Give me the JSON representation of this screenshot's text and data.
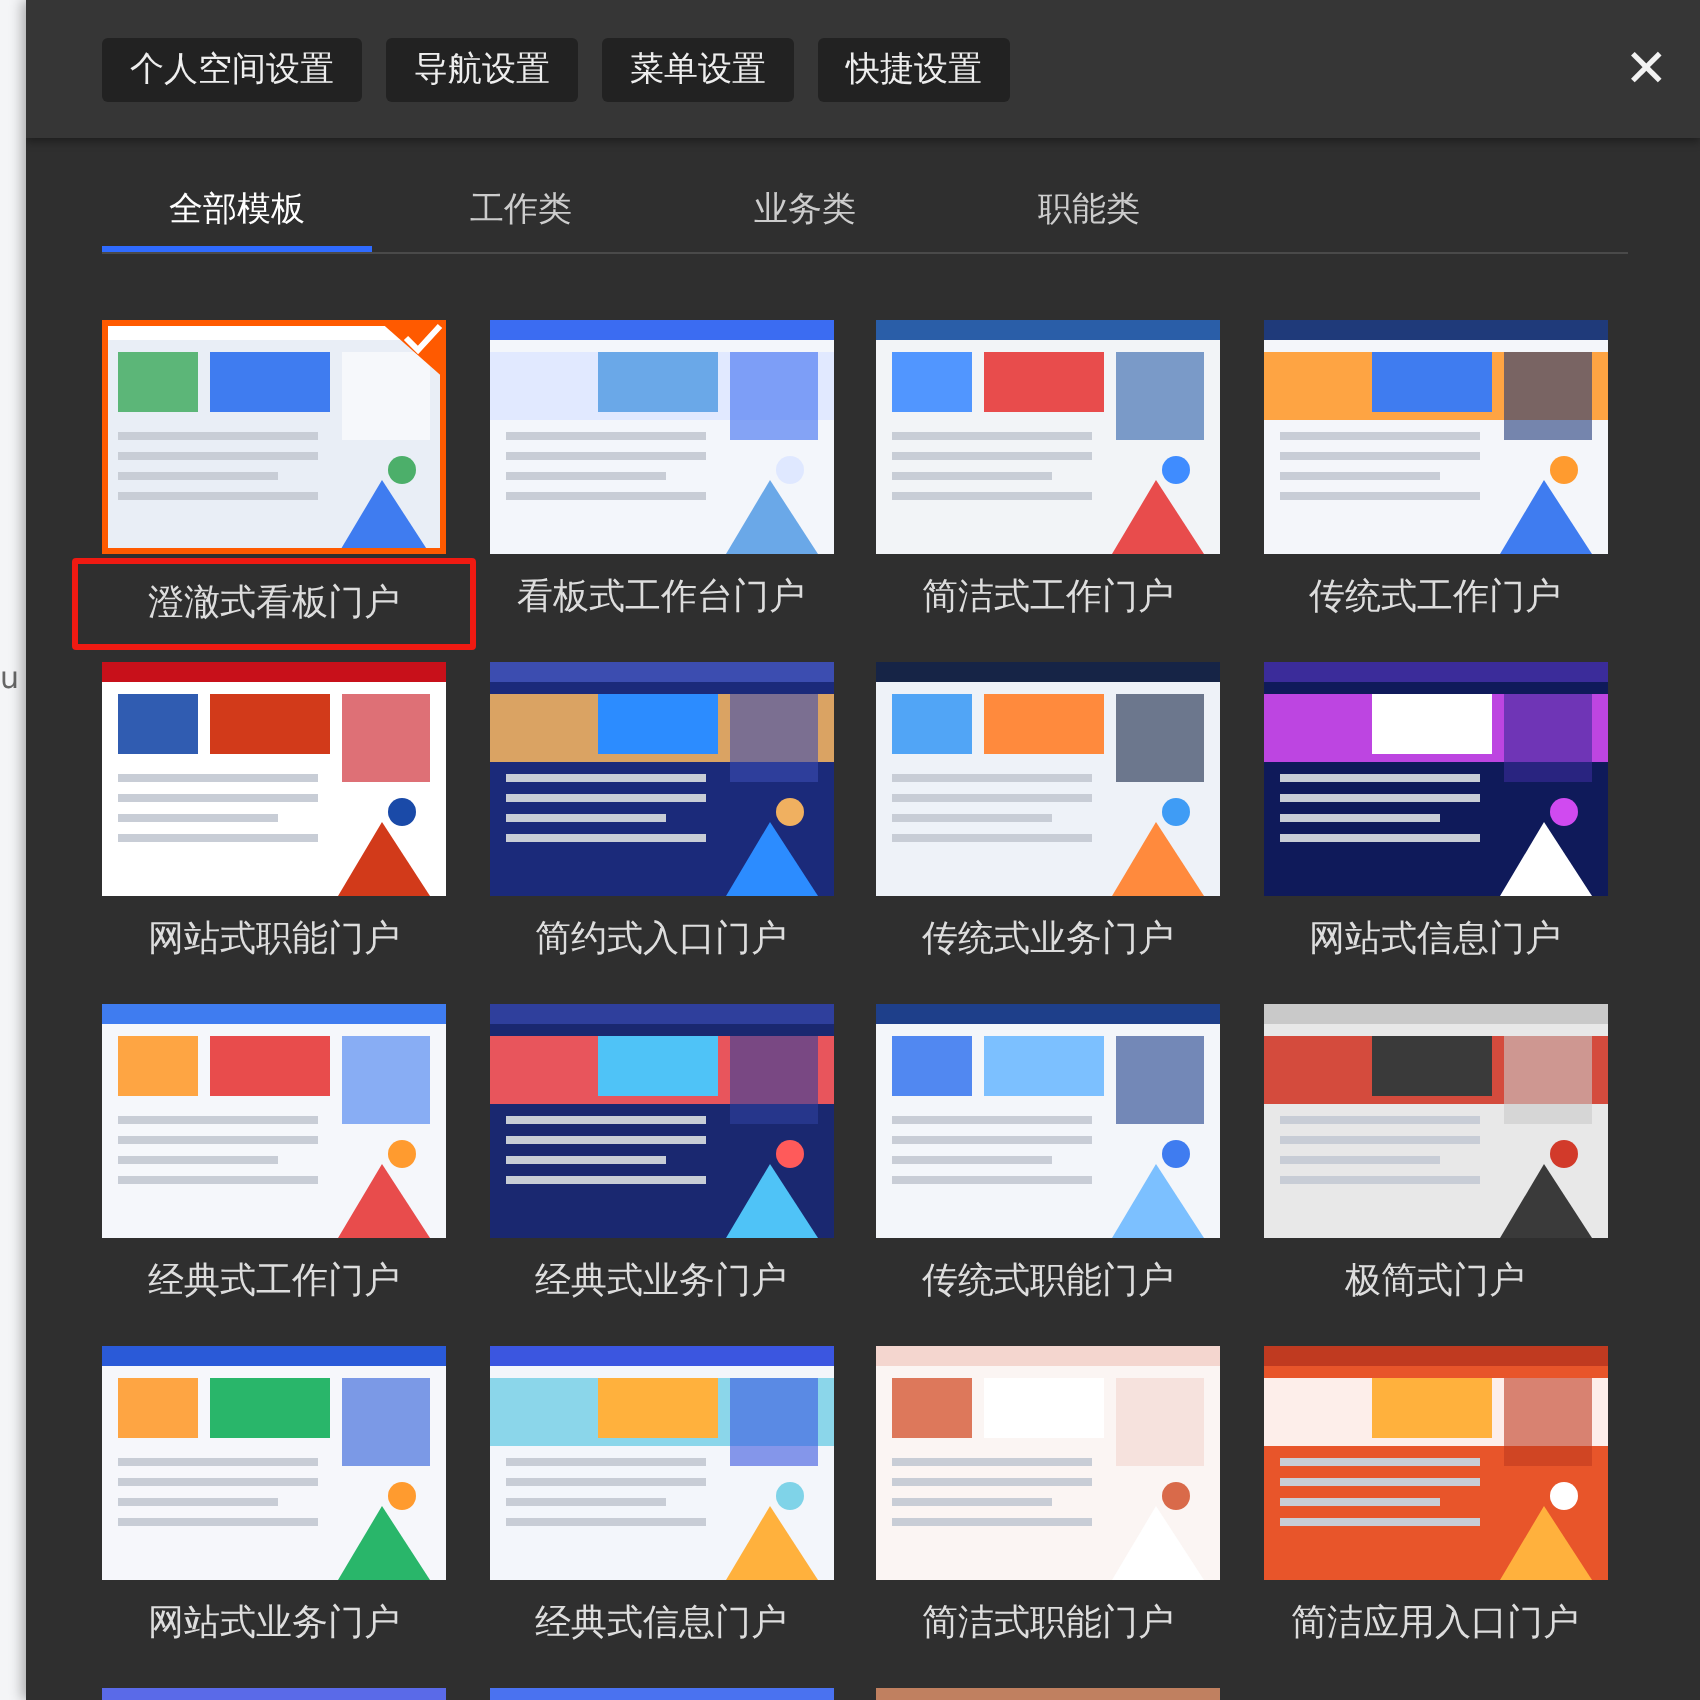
{
  "background_page": {
    "fragments": [
      "u"
    ]
  },
  "toolbar": {
    "buttons": [
      "个人空间设置",
      "导航设置",
      "菜单设置",
      "快捷设置"
    ],
    "close": "✕"
  },
  "tabs": [
    {
      "label": "全部模板",
      "selected": true
    },
    {
      "label": "工作类",
      "selected": false
    },
    {
      "label": "业务类",
      "selected": false
    },
    {
      "label": "职能类",
      "selected": false
    }
  ],
  "templates": [
    {
      "name": "澄澈式看板门户",
      "selected": true,
      "highlighted": true
    },
    {
      "name": "看板式工作台门户",
      "selected": false,
      "highlighted": false
    },
    {
      "name": "简洁式工作门户",
      "selected": false,
      "highlighted": false
    },
    {
      "name": "传统式工作门户",
      "selected": false,
      "highlighted": false
    },
    {
      "name": "网站式职能门户",
      "selected": false,
      "highlighted": false
    },
    {
      "name": "简约式入口门户",
      "selected": false,
      "highlighted": false
    },
    {
      "name": "传统式业务门户",
      "selected": false,
      "highlighted": false
    },
    {
      "name": "网站式信息门户",
      "selected": false,
      "highlighted": false
    },
    {
      "name": "经典式工作门户",
      "selected": false,
      "highlighted": false
    },
    {
      "name": "经典式业务门户",
      "selected": false,
      "highlighted": false
    },
    {
      "name": "传统式职能门户",
      "selected": false,
      "highlighted": false
    },
    {
      "name": "极简式门户",
      "selected": false,
      "highlighted": false
    },
    {
      "name": "网站式业务门户",
      "selected": false,
      "highlighted": false
    },
    {
      "name": "经典式信息门户",
      "selected": false,
      "highlighted": false
    },
    {
      "name": "简洁式职能门户",
      "selected": false,
      "highlighted": false
    },
    {
      "name": "简洁应用入口门户",
      "selected": false,
      "highlighted": false
    },
    {
      "selected": false
    },
    {
      "selected": false
    },
    {
      "selected": false
    }
  ]
}
